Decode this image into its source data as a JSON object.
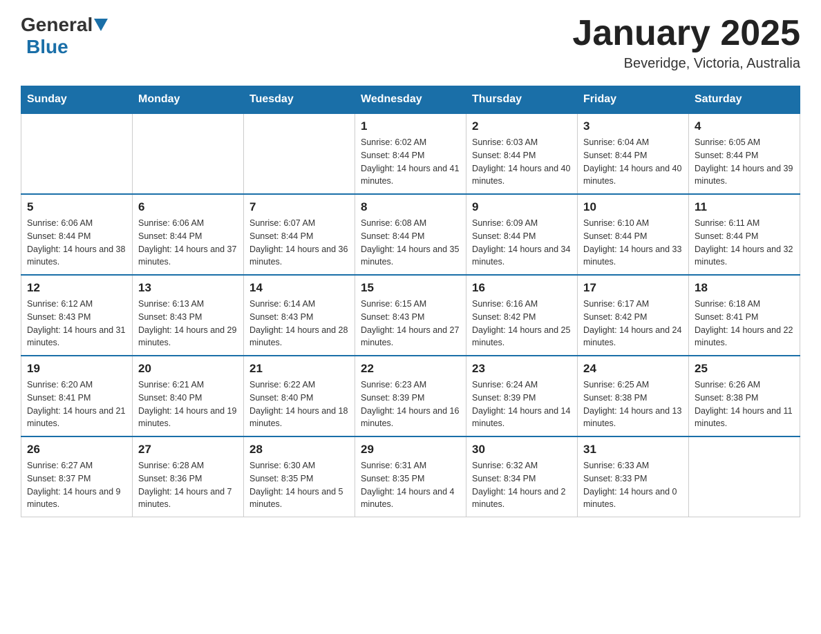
{
  "header": {
    "logo_general": "General",
    "logo_blue": "Blue",
    "month_title": "January 2025",
    "location": "Beveridge, Victoria, Australia"
  },
  "weekdays": [
    "Sunday",
    "Monday",
    "Tuesday",
    "Wednesday",
    "Thursday",
    "Friday",
    "Saturday"
  ],
  "weeks": [
    [
      {
        "day": "",
        "info": ""
      },
      {
        "day": "",
        "info": ""
      },
      {
        "day": "",
        "info": ""
      },
      {
        "day": "1",
        "info": "Sunrise: 6:02 AM\nSunset: 8:44 PM\nDaylight: 14 hours and 41 minutes."
      },
      {
        "day": "2",
        "info": "Sunrise: 6:03 AM\nSunset: 8:44 PM\nDaylight: 14 hours and 40 minutes."
      },
      {
        "day": "3",
        "info": "Sunrise: 6:04 AM\nSunset: 8:44 PM\nDaylight: 14 hours and 40 minutes."
      },
      {
        "day": "4",
        "info": "Sunrise: 6:05 AM\nSunset: 8:44 PM\nDaylight: 14 hours and 39 minutes."
      }
    ],
    [
      {
        "day": "5",
        "info": "Sunrise: 6:06 AM\nSunset: 8:44 PM\nDaylight: 14 hours and 38 minutes."
      },
      {
        "day": "6",
        "info": "Sunrise: 6:06 AM\nSunset: 8:44 PM\nDaylight: 14 hours and 37 minutes."
      },
      {
        "day": "7",
        "info": "Sunrise: 6:07 AM\nSunset: 8:44 PM\nDaylight: 14 hours and 36 minutes."
      },
      {
        "day": "8",
        "info": "Sunrise: 6:08 AM\nSunset: 8:44 PM\nDaylight: 14 hours and 35 minutes."
      },
      {
        "day": "9",
        "info": "Sunrise: 6:09 AM\nSunset: 8:44 PM\nDaylight: 14 hours and 34 minutes."
      },
      {
        "day": "10",
        "info": "Sunrise: 6:10 AM\nSunset: 8:44 PM\nDaylight: 14 hours and 33 minutes."
      },
      {
        "day": "11",
        "info": "Sunrise: 6:11 AM\nSunset: 8:44 PM\nDaylight: 14 hours and 32 minutes."
      }
    ],
    [
      {
        "day": "12",
        "info": "Sunrise: 6:12 AM\nSunset: 8:43 PM\nDaylight: 14 hours and 31 minutes."
      },
      {
        "day": "13",
        "info": "Sunrise: 6:13 AM\nSunset: 8:43 PM\nDaylight: 14 hours and 29 minutes."
      },
      {
        "day": "14",
        "info": "Sunrise: 6:14 AM\nSunset: 8:43 PM\nDaylight: 14 hours and 28 minutes."
      },
      {
        "day": "15",
        "info": "Sunrise: 6:15 AM\nSunset: 8:43 PM\nDaylight: 14 hours and 27 minutes."
      },
      {
        "day": "16",
        "info": "Sunrise: 6:16 AM\nSunset: 8:42 PM\nDaylight: 14 hours and 25 minutes."
      },
      {
        "day": "17",
        "info": "Sunrise: 6:17 AM\nSunset: 8:42 PM\nDaylight: 14 hours and 24 minutes."
      },
      {
        "day": "18",
        "info": "Sunrise: 6:18 AM\nSunset: 8:41 PM\nDaylight: 14 hours and 22 minutes."
      }
    ],
    [
      {
        "day": "19",
        "info": "Sunrise: 6:20 AM\nSunset: 8:41 PM\nDaylight: 14 hours and 21 minutes."
      },
      {
        "day": "20",
        "info": "Sunrise: 6:21 AM\nSunset: 8:40 PM\nDaylight: 14 hours and 19 minutes."
      },
      {
        "day": "21",
        "info": "Sunrise: 6:22 AM\nSunset: 8:40 PM\nDaylight: 14 hours and 18 minutes."
      },
      {
        "day": "22",
        "info": "Sunrise: 6:23 AM\nSunset: 8:39 PM\nDaylight: 14 hours and 16 minutes."
      },
      {
        "day": "23",
        "info": "Sunrise: 6:24 AM\nSunset: 8:39 PM\nDaylight: 14 hours and 14 minutes."
      },
      {
        "day": "24",
        "info": "Sunrise: 6:25 AM\nSunset: 8:38 PM\nDaylight: 14 hours and 13 minutes."
      },
      {
        "day": "25",
        "info": "Sunrise: 6:26 AM\nSunset: 8:38 PM\nDaylight: 14 hours and 11 minutes."
      }
    ],
    [
      {
        "day": "26",
        "info": "Sunrise: 6:27 AM\nSunset: 8:37 PM\nDaylight: 14 hours and 9 minutes."
      },
      {
        "day": "27",
        "info": "Sunrise: 6:28 AM\nSunset: 8:36 PM\nDaylight: 14 hours and 7 minutes."
      },
      {
        "day": "28",
        "info": "Sunrise: 6:30 AM\nSunset: 8:35 PM\nDaylight: 14 hours and 5 minutes."
      },
      {
        "day": "29",
        "info": "Sunrise: 6:31 AM\nSunset: 8:35 PM\nDaylight: 14 hours and 4 minutes."
      },
      {
        "day": "30",
        "info": "Sunrise: 6:32 AM\nSunset: 8:34 PM\nDaylight: 14 hours and 2 minutes."
      },
      {
        "day": "31",
        "info": "Sunrise: 6:33 AM\nSunset: 8:33 PM\nDaylight: 14 hours and 0 minutes."
      },
      {
        "day": "",
        "info": ""
      }
    ]
  ]
}
